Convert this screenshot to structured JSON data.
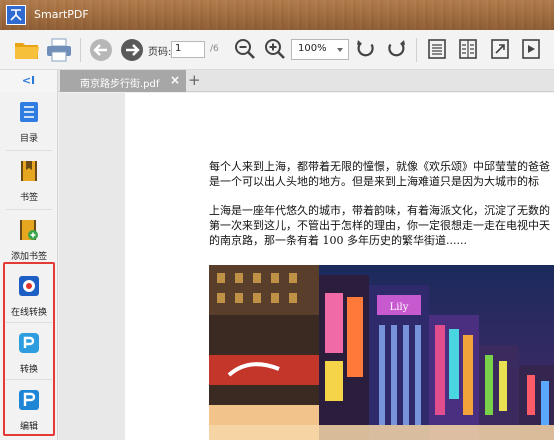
{
  "window": {
    "title": "SmartPDF"
  },
  "toolbar": {
    "page_label": "页码:",
    "page_value": "1",
    "page_total": "/6",
    "zoom": "100%"
  },
  "tabs": [
    {
      "label": "南京路步行街.pdf",
      "close": "×"
    }
  ],
  "new_tab": "+",
  "sidebar": {
    "collapse": "<I",
    "items": [
      {
        "label": "目录",
        "icon": "list-icon"
      },
      {
        "label": "书签",
        "icon": "bookmark-icon"
      },
      {
        "label": "添加书签",
        "icon": "add-bookmark-icon"
      },
      {
        "label": "在线转换",
        "icon": "online-convert-icon"
      },
      {
        "label": "转换",
        "icon": "convert-icon"
      },
      {
        "label": "编辑",
        "icon": "edit-icon"
      }
    ]
  },
  "document": {
    "paragraph1": [
      "每个人来到上海，都带着无限的憧憬，就像《欢乐颂》中邱莹莹的爸爸",
      "是一个可以出人头地的地方。但是来到上海难道只是因为大城市的标"
    ],
    "paragraph2": [
      "上海是一座年代悠久的城市，带着韵味，有着海派文化，沉淀了无数的",
      "第一次来到这儿，不管出于怎样的理由，你一定很想走一走在电视中天",
      "的南京路，那一条有着 100 多年历史的繁华街道......"
    ]
  },
  "colors": {
    "accent": "#2a7ad8",
    "highlight": "#e53935",
    "titlebar": "#a06c3e"
  }
}
